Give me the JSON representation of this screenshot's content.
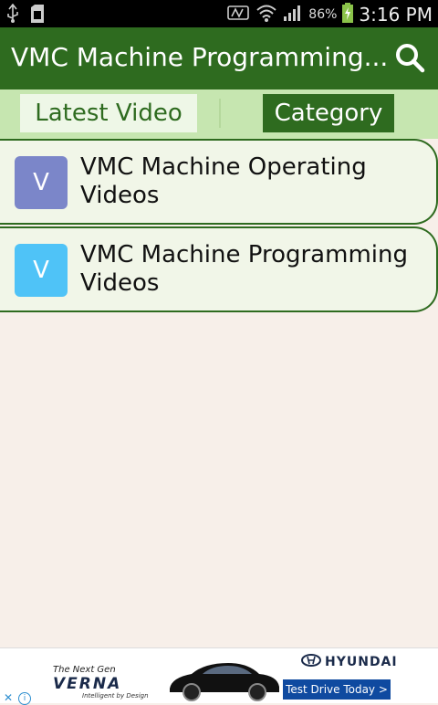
{
  "status_bar": {
    "battery_percent": "86%",
    "time": "3:16 PM"
  },
  "app_bar": {
    "title": "VMC Machine Programming..."
  },
  "tabs": [
    {
      "label": "Latest Video"
    },
    {
      "label": "Category"
    }
  ],
  "list": [
    {
      "avatar_letter": "V",
      "avatar_color": "#7b86c9",
      "title": "VMC Machine Operating Videos"
    },
    {
      "avatar_letter": "V",
      "avatar_color": "#4fc3f7",
      "title": "VMC Machine Programming Videos"
    }
  ],
  "ad": {
    "tagline_top": "The Next Gen",
    "model": "VERNA",
    "tagline_bottom": "Intelligent by Design",
    "brand": "HYUNDAI",
    "cta": "Test Drive Today >"
  },
  "colors": {
    "primary": "#2e6b1f",
    "tab_strip": "#c6e6b0",
    "background": "#f7efe9",
    "card": "#f1f6e8"
  }
}
